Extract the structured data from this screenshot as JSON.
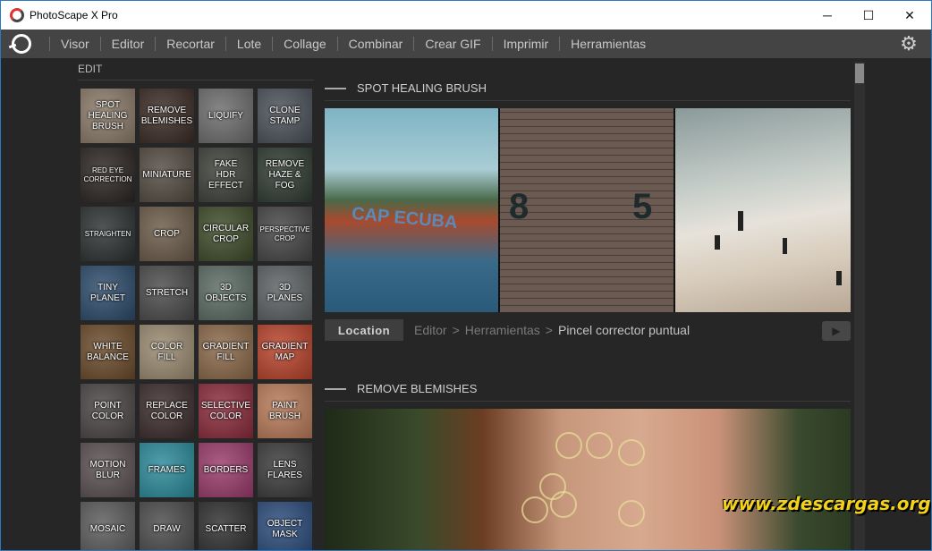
{
  "window": {
    "title": "PhotoScape X Pro",
    "minimize": "─",
    "maximize": "☐",
    "close": "✕"
  },
  "menu": {
    "items": [
      "Visor",
      "Editor",
      "Recortar",
      "Lote",
      "Collage",
      "Combinar",
      "Crear GIF",
      "Imprimir",
      "Herramientas"
    ],
    "settings_icon": "gear-icon"
  },
  "sidebar": {
    "title": "EDIT",
    "tools": [
      {
        "label": "SPOT\nHEALING\nBRUSH",
        "bg": "#8a7a68"
      },
      {
        "label": "REMOVE\nBLEMISHES",
        "bg": "#3a2a24"
      },
      {
        "label": "LIQUIFY",
        "bg": "#6c6c6c"
      },
      {
        "label": "CLONE\nSTAMP",
        "bg": "#4a5058"
      },
      {
        "label": "RED EYE\nCORRECTION",
        "bg": "#2a2420",
        "small": true
      },
      {
        "label": "MINIATURE",
        "bg": "#524a40"
      },
      {
        "label": "FAKE\nHDR EFFECT",
        "bg": "#3c4038"
      },
      {
        "label": "REMOVE\nHAZE & FOG",
        "bg": "#2e3a30"
      },
      {
        "label": "STRAIGHTEN",
        "bg": "#2c3030",
        "small": true
      },
      {
        "label": "CROP",
        "bg": "#6a5a48"
      },
      {
        "label": "CIRCULAR\nCROP",
        "bg": "#3c4a28"
      },
      {
        "label": "PERSPECTIVE\nCROP",
        "bg": "#444444",
        "small": true
      },
      {
        "label": "TINY\nPLANET",
        "bg": "#2c4a6a"
      },
      {
        "label": "STRETCH",
        "bg": "#4a4a4a"
      },
      {
        "label": "3D\nOBJECTS",
        "bg": "#5a6a62"
      },
      {
        "label": "3D\nPLANES",
        "bg": "#5c6062"
      },
      {
        "label": "WHITE\nBALANCE",
        "bg": "#6a4a2a"
      },
      {
        "label": "COLOR\nFILL",
        "bg": "#9a8a70"
      },
      {
        "label": "GRADIENT\nFILL",
        "bg": "#8a6848"
      },
      {
        "label": "GRADIENT\nMAP",
        "bg": "#b8422a"
      },
      {
        "label": "POINT\nCOLOR",
        "bg": "#4a4444"
      },
      {
        "label": "REPLACE\nCOLOR",
        "bg": "#3a2a2a"
      },
      {
        "label": "SELECTIVE\nCOLOR",
        "bg": "#8a2a3a"
      },
      {
        "label": "PAINT\nBRUSH",
        "bg": "#b87a58"
      },
      {
        "label": "MOTION\nBLUR",
        "bg": "#5a5050"
      },
      {
        "label": "FRAMES",
        "bg": "#2a8a9a"
      },
      {
        "label": "BORDERS",
        "bg": "#9a3a6a"
      },
      {
        "label": "LENS\nFLARES",
        "bg": "#3a3a3a"
      },
      {
        "label": "MOSAIC",
        "bg": "#5a5a5a"
      },
      {
        "label": "DRAW",
        "bg": "#4a4a4a"
      },
      {
        "label": "SCATTER",
        "bg": "#2e2e2e"
      },
      {
        "label": "OBJECT\nMASK",
        "bg": "#2a4a7a"
      }
    ]
  },
  "section1": {
    "title": "SPOT HEALING BRUSH",
    "location_button": "Location",
    "crumbs": [
      "Editor",
      "Herramientas"
    ],
    "current": "Pincel corrector puntual",
    "photo_texts": [
      "CAP ECUBA",
      "8",
      "5"
    ]
  },
  "section2": {
    "title": "REMOVE BLEMISHES"
  },
  "watermark": "www.zdescargas.org"
}
